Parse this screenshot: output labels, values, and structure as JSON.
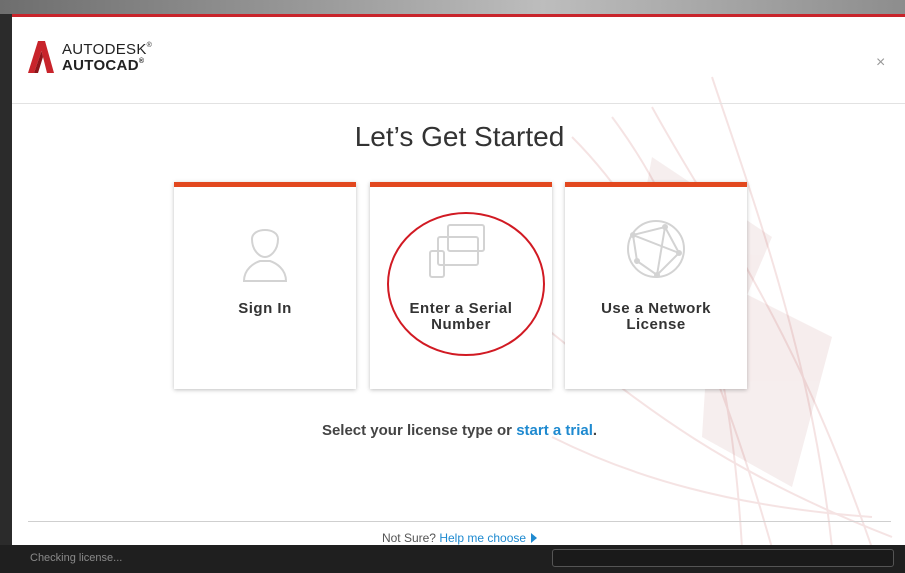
{
  "app": {
    "brand": "AUTODESK",
    "product": "AUTOCAD",
    "mark": "®"
  },
  "dialog": {
    "title": "Let’s Get Started",
    "close_icon": "×",
    "cards": [
      {
        "line1": "Sign In",
        "line2": "",
        "icon": "user-silhouette-icon"
      },
      {
        "line1": "Enter a Serial",
        "line2": "Number",
        "icon": "devices-icon"
      },
      {
        "line1": "Use a Network",
        "line2": "License",
        "icon": "network-globe-icon"
      }
    ],
    "prompt_text": "Select your license type or ",
    "trial_link": "start a trial",
    "prompt_end": ".",
    "footer_text": "Not Sure? ",
    "help_link": "Help me choose"
  },
  "status": {
    "text": "Checking license..."
  },
  "colors": {
    "accent": "#e2481f",
    "header_rule": "#c8242b",
    "link": "#1f8ad0",
    "annotation": "#d11a23"
  }
}
